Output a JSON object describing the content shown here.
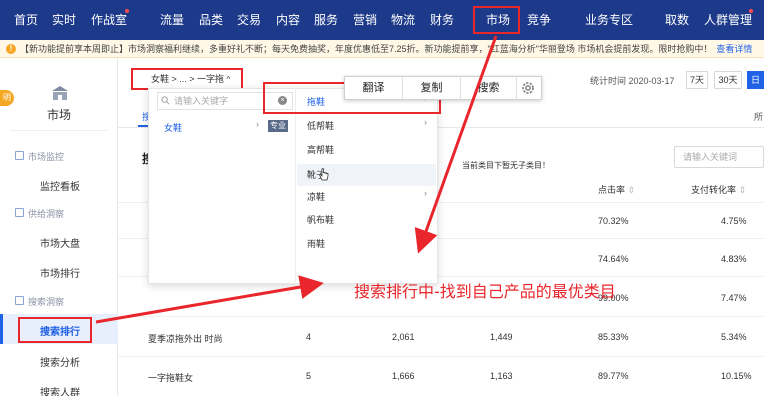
{
  "topnav": {
    "items": [
      {
        "label": "首页"
      },
      {
        "label": "实时"
      },
      {
        "label": "作战室"
      },
      {
        "label": "流量"
      },
      {
        "label": "品类"
      },
      {
        "label": "交易"
      },
      {
        "label": "内容"
      },
      {
        "label": "服务"
      },
      {
        "label": "营销"
      },
      {
        "label": "物流"
      },
      {
        "label": "财务"
      },
      {
        "label": "市场"
      },
      {
        "label": "竞争"
      },
      {
        "label": "业务专区"
      },
      {
        "label": "取数"
      },
      {
        "label": "人群管理"
      }
    ],
    "active": "市场",
    "bg_color": "#1d3a8a"
  },
  "notice": {
    "text": "【新功能提前享本周即止】市场洞察福利继续，多重好礼不断；每天免费抽奖，年度优惠低至7.25折。新功能提前享，\"红蓝海分析\"华丽登场 市场机会提前发现。限时抢购中！",
    "link": "查看详情"
  },
  "sidebar": {
    "badge": "明",
    "title": "市场",
    "groups": [
      {
        "label": "市场监控",
        "items": [
          "监控看板"
        ]
      },
      {
        "label": "供给洞察",
        "items": [
          "市场大盘",
          "市场排行"
        ]
      },
      {
        "label": "搜索洞察",
        "items": [
          "搜索排行",
          "搜索分析",
          "搜索人群"
        ]
      }
    ],
    "active_item": "搜索排行"
  },
  "main": {
    "category_path": "女鞋 > ... > 一字拖",
    "stat_time": "统计时间 2020-03-17",
    "periods": [
      "7天",
      "30天",
      "日"
    ],
    "tab_first": "搜",
    "tab_right": "所",
    "section_title": "搜",
    "search_placeholder": "请输入关键词",
    "headers": {
      "c0": "搜",
      "c1": "点击率",
      "c2": "支付转化率"
    },
    "rows": [
      {
        "c0": "",
        "rank": "",
        "v1": "",
        "v2": "",
        "click": "70.32%",
        "conv": "4.75%"
      },
      {
        "c0": "",
        "rank": "",
        "v1": "",
        "v2": "",
        "click": "74.64%",
        "conv": "4.83%"
      },
      {
        "c0": "",
        "rank": "",
        "v1": "",
        "v2": "",
        "click": "99.00%",
        "conv": "7.47%"
      },
      {
        "c0": "夏季凉拖外出 时尚",
        "rank": "4",
        "v1": "2,061",
        "v2": "1,449",
        "click": "85.33%",
        "conv": "5.34%"
      },
      {
        "c0": "一字拖鞋女",
        "rank": "5",
        "v1": "1,666",
        "v2": "1,163",
        "click": "89.77%",
        "conv": "10.15%"
      }
    ]
  },
  "dropdown": {
    "placeholder": "请输入关键字",
    "col1": [
      {
        "label": "女鞋",
        "tag": "专业"
      }
    ],
    "col2": [
      "拖鞋",
      "低帮鞋",
      "高帮鞋",
      "靴子",
      "凉鞋",
      "帆布鞋",
      "雨鞋"
    ],
    "selected": "拖鞋",
    "hover": "靴子",
    "empty_text": "当前类目下暂无子类目！"
  },
  "context_menu": {
    "items": [
      "翻译",
      "复制",
      "搜索"
    ],
    "icon": "gear-icon"
  },
  "annotation": {
    "text": "搜索排行中-找到自己产品的最优类目",
    "color": "#e8262b"
  }
}
